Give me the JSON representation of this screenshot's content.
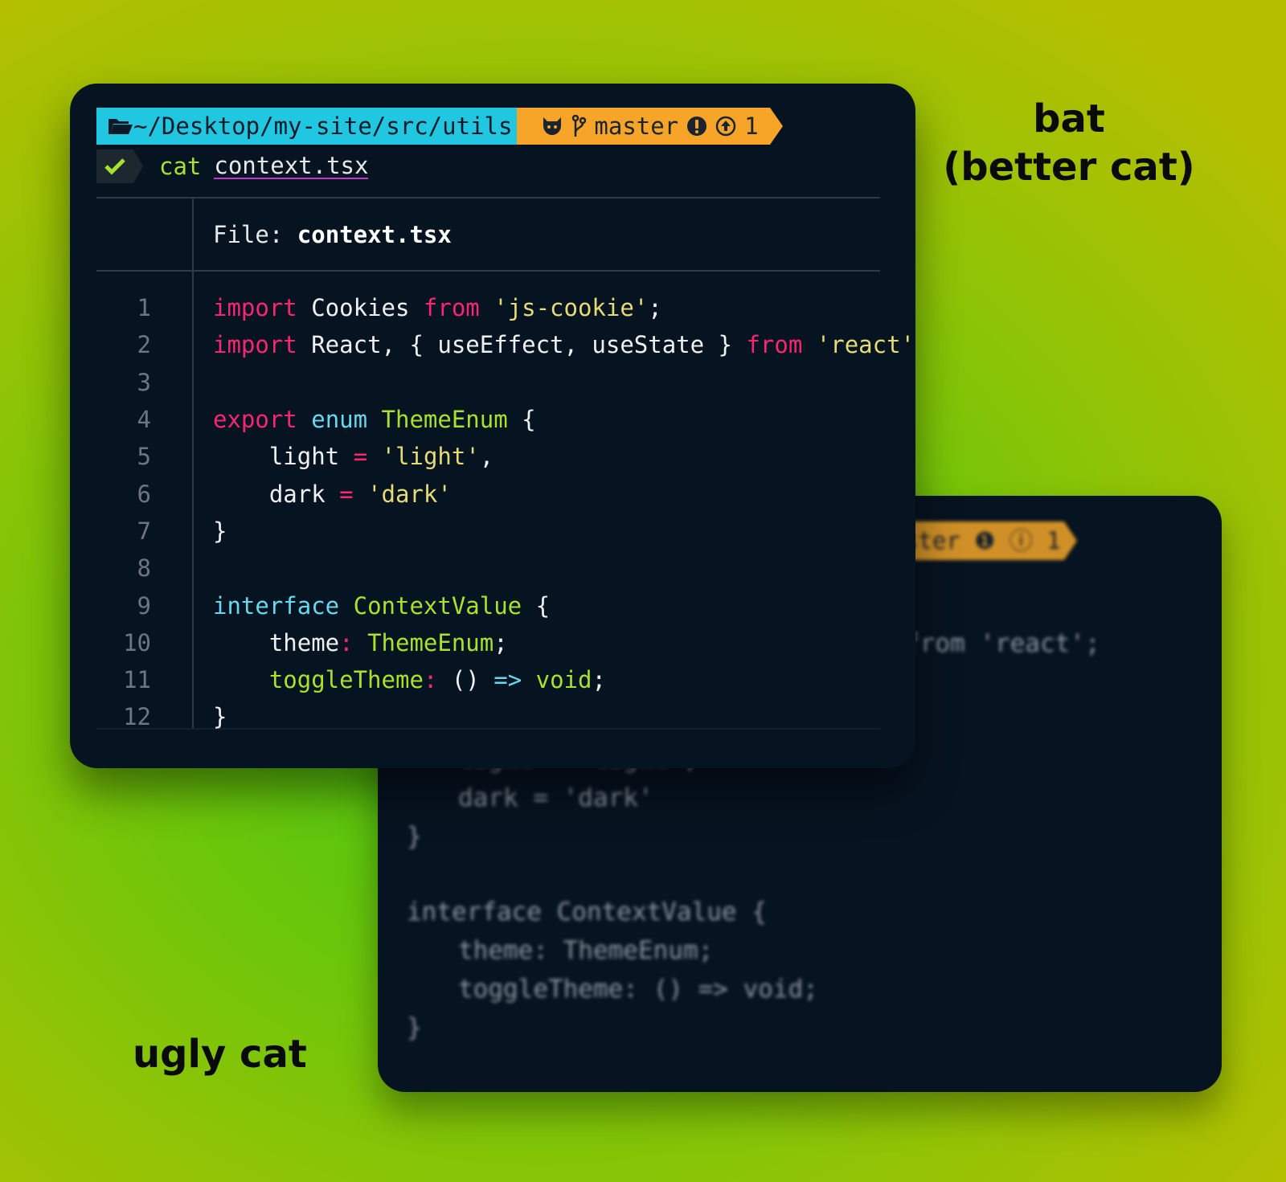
{
  "captions": {
    "bat_line1": "bat",
    "bat_line2": "(better cat)",
    "ugly": "ugly cat"
  },
  "prompt": {
    "path": "~/Desktop/my-site/src/utils",
    "branch": "master",
    "ahead_count": "1",
    "command": "cat",
    "argument": "context.tsx",
    "icons": [
      "folder-icon",
      "github-icon",
      "git-branch-icon",
      "warning-icon",
      "arrow-up-circle-icon",
      "check-icon"
    ]
  },
  "file_header": {
    "label": "File:",
    "name": "context.tsx"
  },
  "code": {
    "line_numbers": [
      "1",
      "2",
      "3",
      "4",
      "5",
      "6",
      "7",
      "8",
      "9",
      "10",
      "11",
      "12"
    ],
    "tokens": {
      "import": "import",
      "from": "from",
      "cookies": " Cookies ",
      "js_cookie": "'js-cookie'",
      "semi": ";",
      "react_destructure": " React, { useEffect, useState } ",
      "react_str": "'react'",
      "export": "export",
      "enum": "enum",
      "theme_enum": "ThemeEnum",
      "open_brace": " {",
      "light_key": "light",
      "eq": "=",
      "light_val": "'light'",
      "comma": ",",
      "dark_key": "dark",
      "dark_val": "'dark'",
      "close_brace": "}",
      "interface": "interface",
      "context_value": "ContextValue",
      "theme_key": "theme",
      "colon": ":",
      "theme_type": "ThemeEnum",
      "toggle_key": "toggleTheme",
      "parens": "()",
      "arrow": "=>",
      "void": "void"
    }
  },
  "back_terminal": {
    "branch": "master",
    "ahead_count": "1",
    "line_react": "from 'react';",
    "line_light": "light = 'light',",
    "line_dark": "dark = 'dark'",
    "line_close": "}",
    "line_interface": "interface ContextValue {",
    "line_theme": "theme: ThemeEnum;",
    "line_toggle": "toggleTheme: () => void;",
    "line_close2": "}"
  },
  "colors": {
    "keyword": "#f92672",
    "string": "#e6db74",
    "type_blue": "#66d9ef",
    "type_green": "#a6e22e",
    "path_segment": "#21c7e0",
    "git_segment": "#f7a529",
    "terminal_bg": "#061320"
  }
}
